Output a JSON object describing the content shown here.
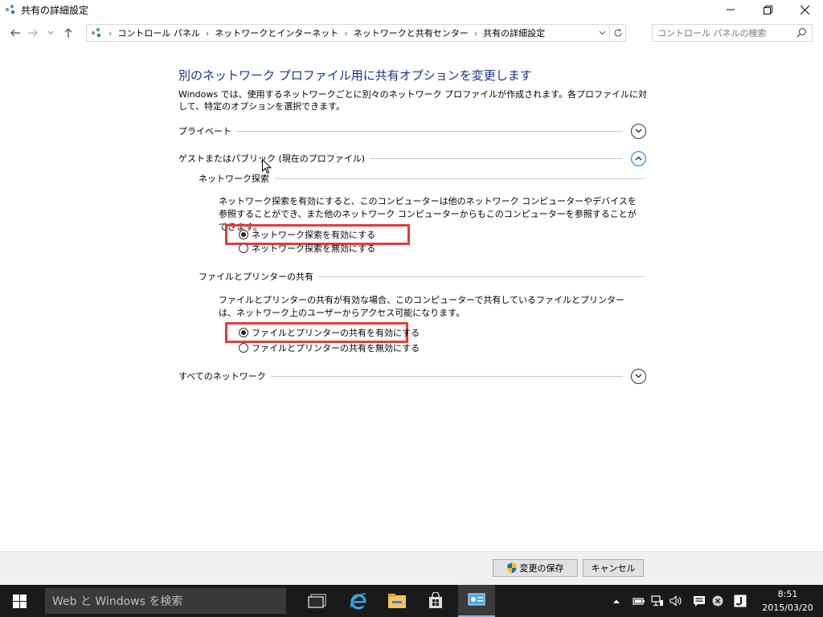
{
  "window": {
    "title": "共有の詳細設定"
  },
  "address": {
    "crumbs": [
      "コントロール パネル",
      "ネットワークとインターネット",
      "ネットワークと共有センター",
      "共有の詳細設定"
    ],
    "search_placeholder": "コントロール パネルの検索"
  },
  "page": {
    "heading": "別のネットワーク プロファイル用に共有オプションを変更します",
    "description": "Windows では、使用するネットワークごとに別々のネットワーク プロファイルが作成されます。各プロファイルに対して、特定のオプションを選択できます。"
  },
  "sections": {
    "private": {
      "label": "プライベート",
      "expanded": false
    },
    "guest": {
      "label": "ゲストまたはパブリック (現在のプロファイル)",
      "expanded": true
    },
    "all": {
      "label": "すべてのネットワーク",
      "expanded": false
    }
  },
  "discovery": {
    "title": "ネットワーク探索",
    "description": "ネットワーク探索を有効にすると、このコンピューターは他のネットワーク コンピューターやデバイスを参照することができ、また他のネットワーク コンピューターからもこのコンピューターを参照することができます。",
    "option_on": "ネットワーク探索を有効にする",
    "option_off": "ネットワーク探索を無効にする",
    "selected": "on"
  },
  "file_sharing": {
    "title": "ファイルとプリンターの共有",
    "description": "ファイルとプリンターの共有が有効な場合、このコンピューターで共有しているファイルとプリンターは、ネットワーク上のユーザーからアクセス可能になります。",
    "option_on": "ファイルとプリンターの共有を有効にする",
    "option_off": "ファイルとプリンターの共有を無効にする",
    "selected": "on"
  },
  "buttons": {
    "save": "変更の保存",
    "cancel": "キャンセル"
  },
  "taskbar": {
    "search_placeholder": "Web と Windows を検索",
    "time": "8:51",
    "date": "2015/03/20"
  },
  "colors": {
    "heading": "#1e3287",
    "highlight": "#e83a3a",
    "taskbar": "#1a1a1a",
    "accent": "#76b9ed"
  },
  "icons": {
    "app": "network-icon",
    "save_button": "uac-shield-icon",
    "start": "windows-logo-icon"
  }
}
